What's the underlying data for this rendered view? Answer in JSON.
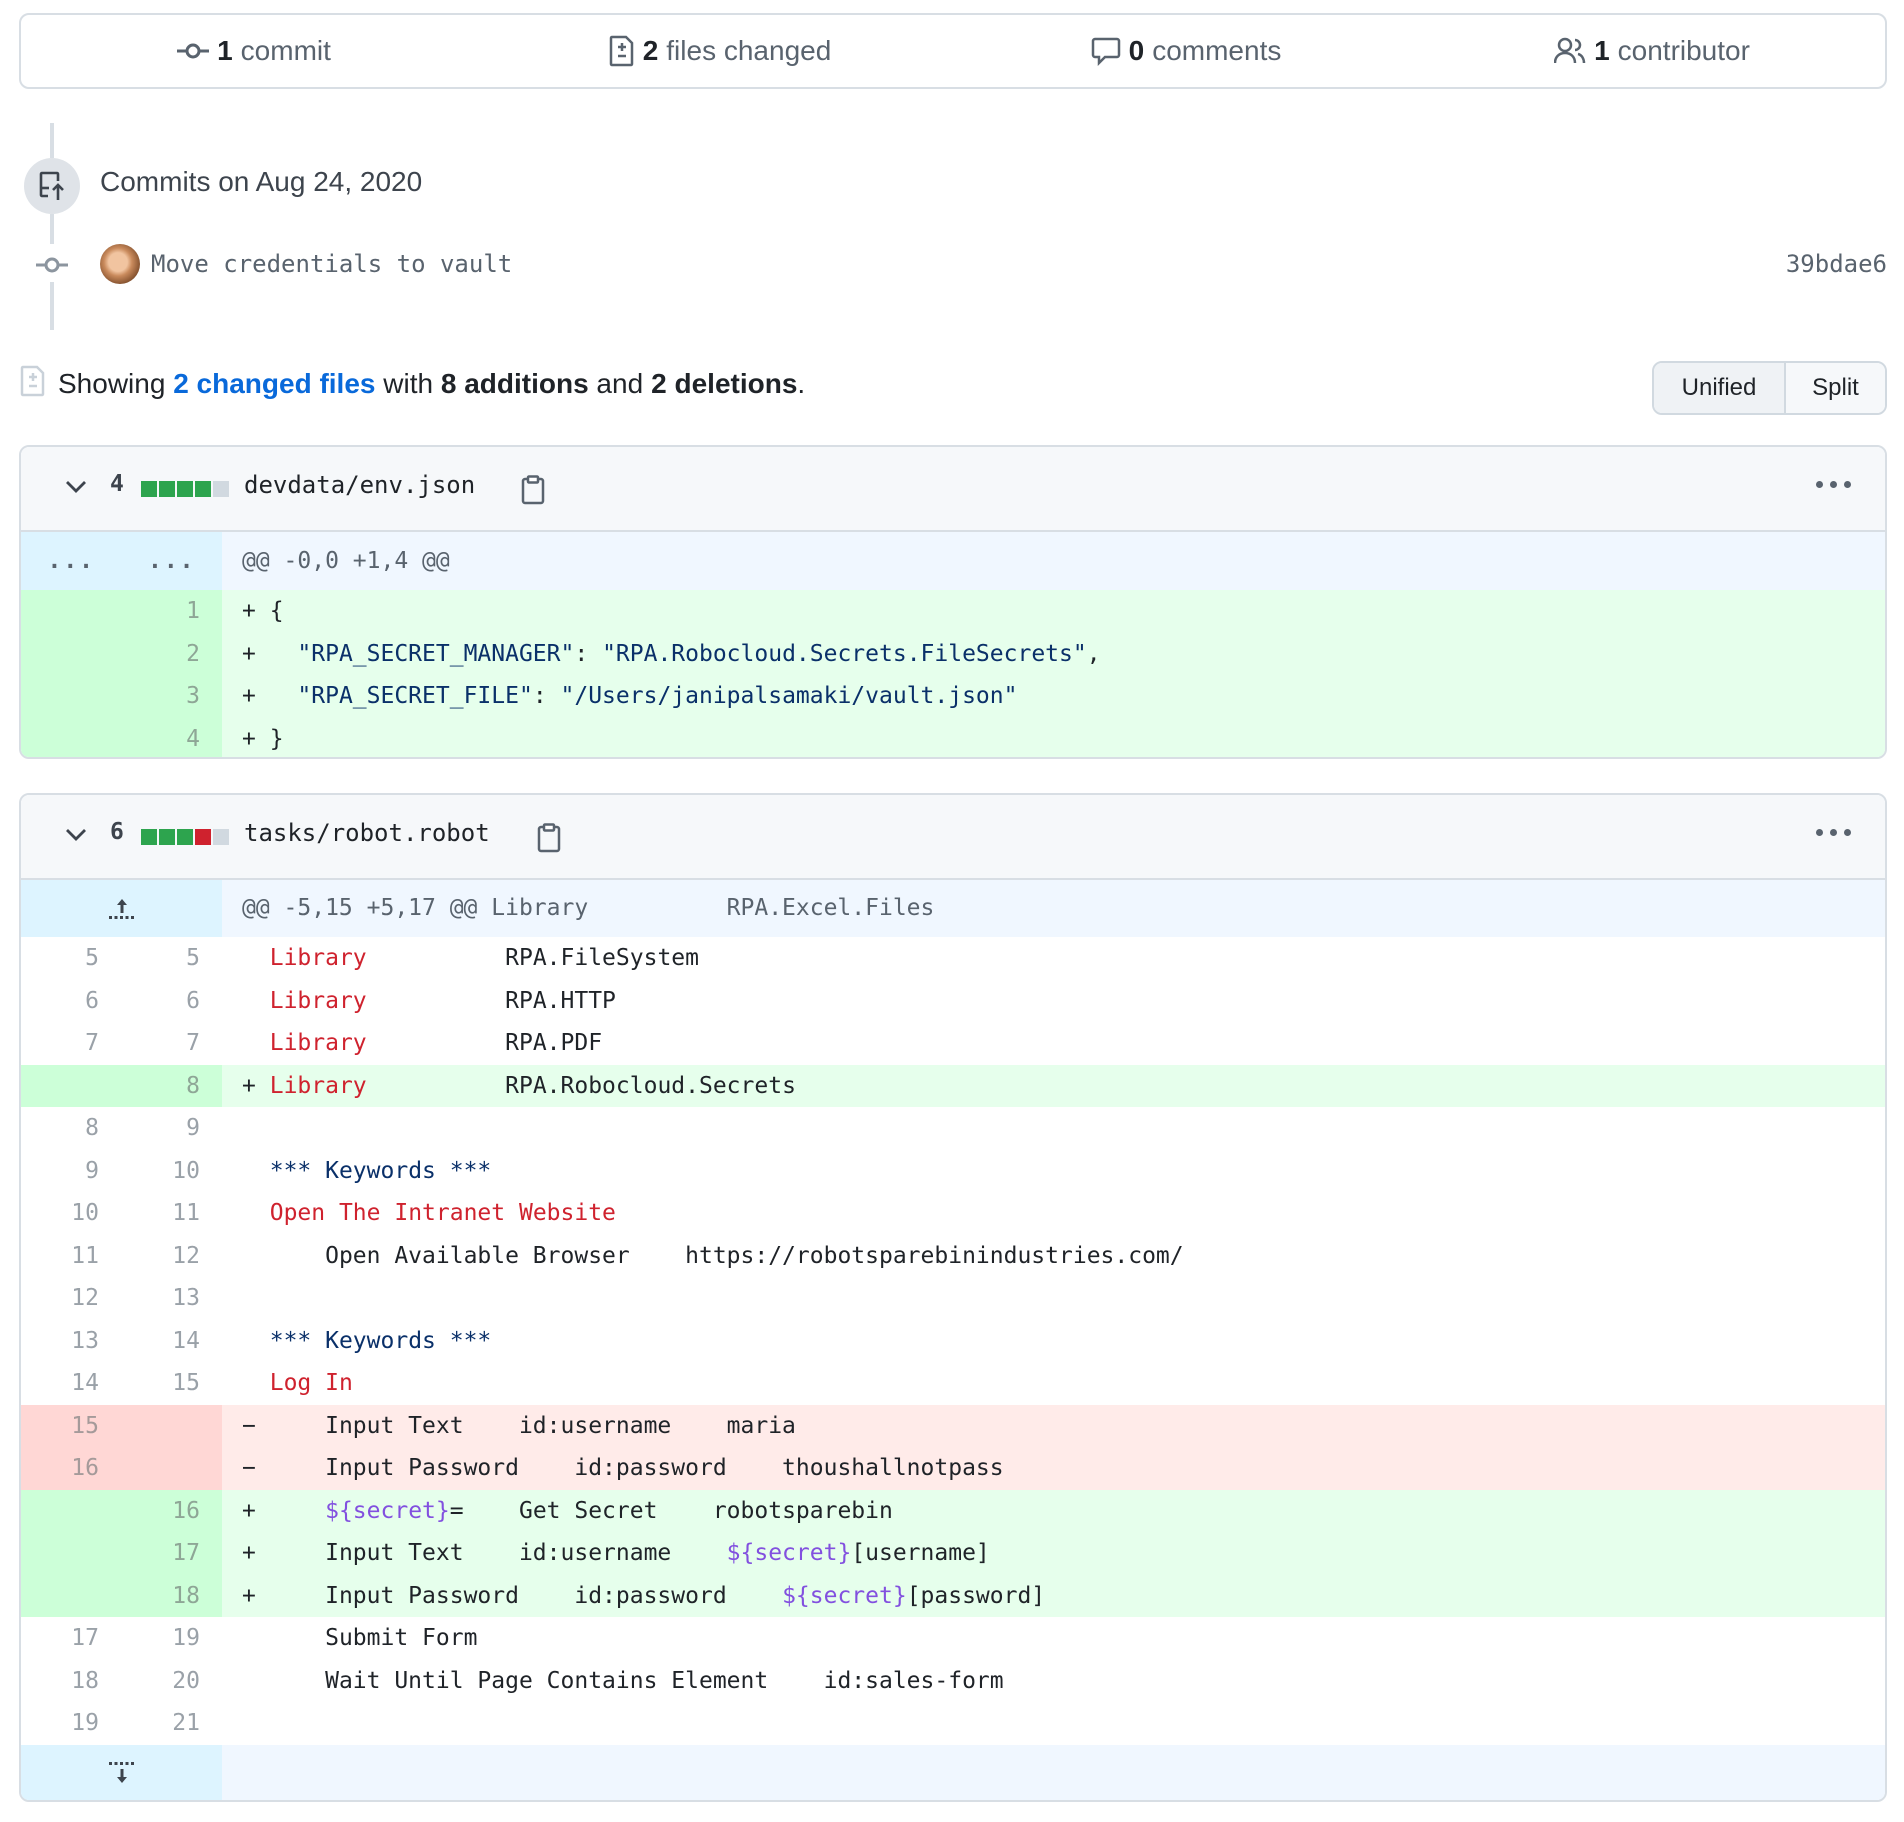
{
  "summary": {
    "commits": {
      "count": "1",
      "label": "commit",
      "icon": "git-commit-icon"
    },
    "files": {
      "count": "2",
      "label": "files changed",
      "icon": "file-diff-icon"
    },
    "comments": {
      "count": "0",
      "label": "comments",
      "icon": "comment-icon"
    },
    "contributors": {
      "count": "1",
      "label": "contributor",
      "icon": "people-icon"
    }
  },
  "timeline": {
    "date_heading": "Commits on Aug 24, 2020",
    "commit": {
      "message": "Move credentials to vault",
      "sha": "39bdae6",
      "avatar": "user-avatar"
    }
  },
  "diff_summary": {
    "prefix": "Showing",
    "link": "2 changed files",
    "mid1": "with",
    "additions": "8 additions",
    "mid2": "and",
    "deletions": "2 deletions",
    "suffix": "."
  },
  "view_toggle": {
    "unified": "Unified",
    "split": "Split",
    "selected": "Unified"
  },
  "colors": {
    "add": "#2da44e",
    "del": "#cf222e",
    "link": "#0969da"
  },
  "files": [
    {
      "count": "4",
      "stat": [
        "add",
        "add",
        "add",
        "add",
        "neutral"
      ],
      "name": "devdata/env.json",
      "hunk": {
        "old": "...",
        "new": "...",
        "header": "@@ -0,0 +1,4 @@"
      },
      "lines": [
        {
          "type": "add",
          "old": "",
          "new": "1",
          "prefix": "+",
          "text": " {"
        },
        {
          "type": "add",
          "old": "",
          "new": "2",
          "prefix": "+",
          "text": "   \"RPA_SECRET_MANAGER\": \"RPA.Robocloud.Secrets.FileSecrets\","
        },
        {
          "type": "add",
          "old": "",
          "new": "3",
          "prefix": "+",
          "text": "   \"RPA_SECRET_FILE\": \"/Users/janipalsamaki/vault.json\""
        },
        {
          "type": "add",
          "old": "",
          "new": "4",
          "prefix": "+",
          "text": " }"
        }
      ]
    },
    {
      "count": "6",
      "stat": [
        "add",
        "add",
        "add",
        "del",
        "neutral"
      ],
      "name": "tasks/robot.robot",
      "hunk": {
        "header": "@@ -5,15 +5,17 @@ Library          RPA.Excel.Files"
      },
      "lines": [
        {
          "type": "ctx",
          "old": "5",
          "new": "5",
          "prefix": " ",
          "text": " Library          RPA.FileSystem"
        },
        {
          "type": "ctx",
          "old": "6",
          "new": "6",
          "prefix": " ",
          "text": " Library          RPA.HTTP"
        },
        {
          "type": "ctx",
          "old": "7",
          "new": "7",
          "prefix": " ",
          "text": " Library          RPA.PDF"
        },
        {
          "type": "add",
          "old": "",
          "new": "8",
          "prefix": "+",
          "text": " Library          RPA.Robocloud.Secrets"
        },
        {
          "type": "ctx",
          "old": "8",
          "new": "9",
          "prefix": " ",
          "text": ""
        },
        {
          "type": "ctx",
          "old": "9",
          "new": "10",
          "prefix": " ",
          "text": " *** Keywords ***"
        },
        {
          "type": "ctx",
          "old": "10",
          "new": "11",
          "prefix": " ",
          "text": " Open The Intranet Website"
        },
        {
          "type": "ctx",
          "old": "11",
          "new": "12",
          "prefix": " ",
          "text": "     Open Available Browser    https://robotsparebinindustries.com/"
        },
        {
          "type": "ctx",
          "old": "12",
          "new": "13",
          "prefix": " ",
          "text": ""
        },
        {
          "type": "ctx",
          "old": "13",
          "new": "14",
          "prefix": " ",
          "text": " *** Keywords ***"
        },
        {
          "type": "ctx",
          "old": "14",
          "new": "15",
          "prefix": " ",
          "text": " Log In"
        },
        {
          "type": "del",
          "old": "15",
          "new": "",
          "prefix": "-",
          "text": "     Input Text    id:username    maria"
        },
        {
          "type": "del",
          "old": "16",
          "new": "",
          "prefix": "-",
          "text": "     Input Password    id:password    thoushallnotpass"
        },
        {
          "type": "add",
          "old": "",
          "new": "16",
          "prefix": "+",
          "text": "     ${secret}=    Get Secret    robotsparebin"
        },
        {
          "type": "add",
          "old": "",
          "new": "17",
          "prefix": "+",
          "text": "     Input Text    id:username    ${secret}[username]"
        },
        {
          "type": "add",
          "old": "",
          "new": "18",
          "prefix": "+",
          "text": "     Input Password    id:password    ${secret}[password]"
        },
        {
          "type": "ctx",
          "old": "17",
          "new": "19",
          "prefix": " ",
          "text": "     Submit Form"
        },
        {
          "type": "ctx",
          "old": "18",
          "new": "20",
          "prefix": " ",
          "text": "     Wait Until Page Contains Element    id:sales-form"
        },
        {
          "type": "ctx",
          "old": "19",
          "new": "21",
          "prefix": " ",
          "text": ""
        }
      ]
    }
  ]
}
